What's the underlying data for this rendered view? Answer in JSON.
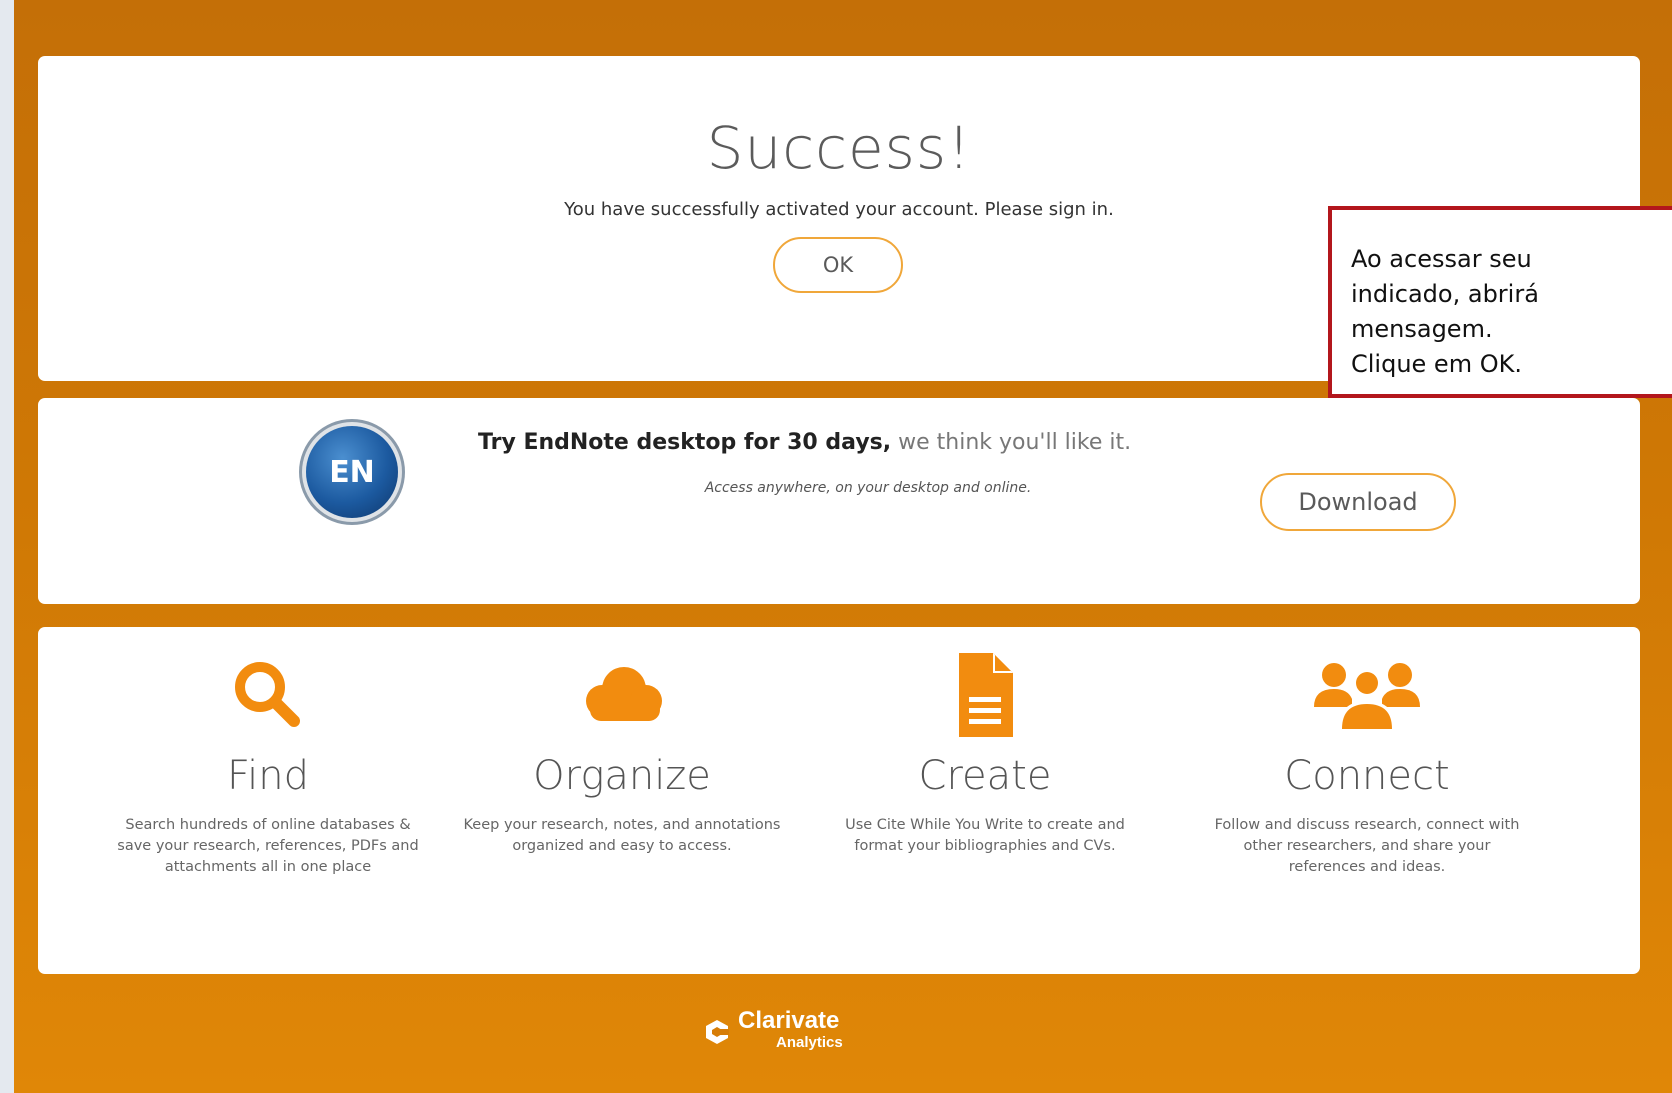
{
  "success": {
    "title": "Success!",
    "message": "You have successfully activated your account. Please sign in.",
    "ok_label": "OK"
  },
  "endnote": {
    "logo_text": "EN",
    "headline_bold": "Try EndNote desktop for 30 days,",
    "headline_rest": " we think you'll like it.",
    "subtitle": "Access anywhere, on your desktop and online.",
    "download_label": "Download"
  },
  "features": [
    {
      "icon": "search-icon",
      "title": "Find",
      "description": "Search hundreds of online databases & save your research, references, PDFs and attachments all in one place"
    },
    {
      "icon": "cloud-icon",
      "title": "Organize",
      "description": "Keep your research, notes, and annotations organized and easy to access."
    },
    {
      "icon": "document-icon",
      "title": "Create",
      "description": "Use Cite While You Write to create and format your bibliographies and CVs."
    },
    {
      "icon": "people-icon",
      "title": "Connect",
      "description": "Follow and discuss research, connect with other researchers, and share your references and ideas."
    }
  ],
  "footer": {
    "brand": "Clarivate",
    "brand_sub": "Analytics"
  },
  "callout": {
    "lines": [
      "Ao acessar seu",
      "indicado, abrirá",
      "mensagem.",
      "Clique em OK."
    ]
  },
  "colors": {
    "accent": "#f28c0f",
    "background_top": "#c46f07",
    "background_bottom": "#e08707",
    "callout_border": "#b3161c"
  }
}
